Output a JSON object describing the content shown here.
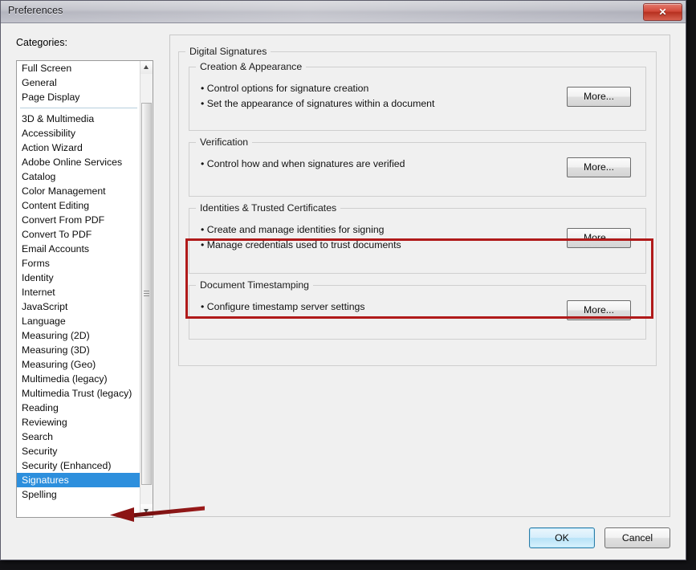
{
  "window": {
    "title": "Preferences",
    "close_label": "✕"
  },
  "sidebar": {
    "label": "Categories:",
    "selected": "Signatures",
    "items_top": [
      {
        "label": "Full Screen"
      },
      {
        "label": "General"
      },
      {
        "label": "Page Display"
      }
    ],
    "items_main": [
      {
        "label": "3D & Multimedia"
      },
      {
        "label": "Accessibility"
      },
      {
        "label": "Action Wizard"
      },
      {
        "label": "Adobe Online Services"
      },
      {
        "label": "Catalog"
      },
      {
        "label": "Color Management"
      },
      {
        "label": "Content Editing"
      },
      {
        "label": "Convert From PDF"
      },
      {
        "label": "Convert To PDF"
      },
      {
        "label": "Email Accounts"
      },
      {
        "label": "Forms"
      },
      {
        "label": "Identity"
      },
      {
        "label": "Internet"
      },
      {
        "label": "JavaScript"
      },
      {
        "label": "Language"
      },
      {
        "label": "Measuring (2D)"
      },
      {
        "label": "Measuring (3D)"
      },
      {
        "label": "Measuring (Geo)"
      },
      {
        "label": "Multimedia (legacy)"
      },
      {
        "label": "Multimedia Trust (legacy)"
      },
      {
        "label": "Reading"
      },
      {
        "label": "Reviewing"
      },
      {
        "label": "Search"
      },
      {
        "label": "Security"
      },
      {
        "label": "Security (Enhanced)"
      },
      {
        "label": "Signatures"
      },
      {
        "label": "Spelling"
      }
    ]
  },
  "main": {
    "group_title": "Digital Signatures",
    "sections": [
      {
        "title": "Creation & Appearance",
        "bullets": [
          "• Control options for signature creation",
          "• Set the appearance of signatures within a document"
        ],
        "button": "More..."
      },
      {
        "title": "Verification",
        "bullets": [
          "• Control how and when signatures are verified"
        ],
        "button": "More..."
      },
      {
        "title": "Identities & Trusted Certificates",
        "bullets": [
          "• Create and manage identities for signing",
          "• Manage credentials used to trust documents"
        ],
        "button": "More..."
      },
      {
        "title": "Document Timestamping",
        "bullets": [
          "• Configure timestamp server settings"
        ],
        "button": "More..."
      }
    ]
  },
  "footer": {
    "ok_label": "OK",
    "cancel_label": "Cancel"
  },
  "annotations": {
    "highlight_color": "#b01a1a",
    "arrow_color": "#8c1414",
    "selection_color": "#2d8fdd"
  }
}
